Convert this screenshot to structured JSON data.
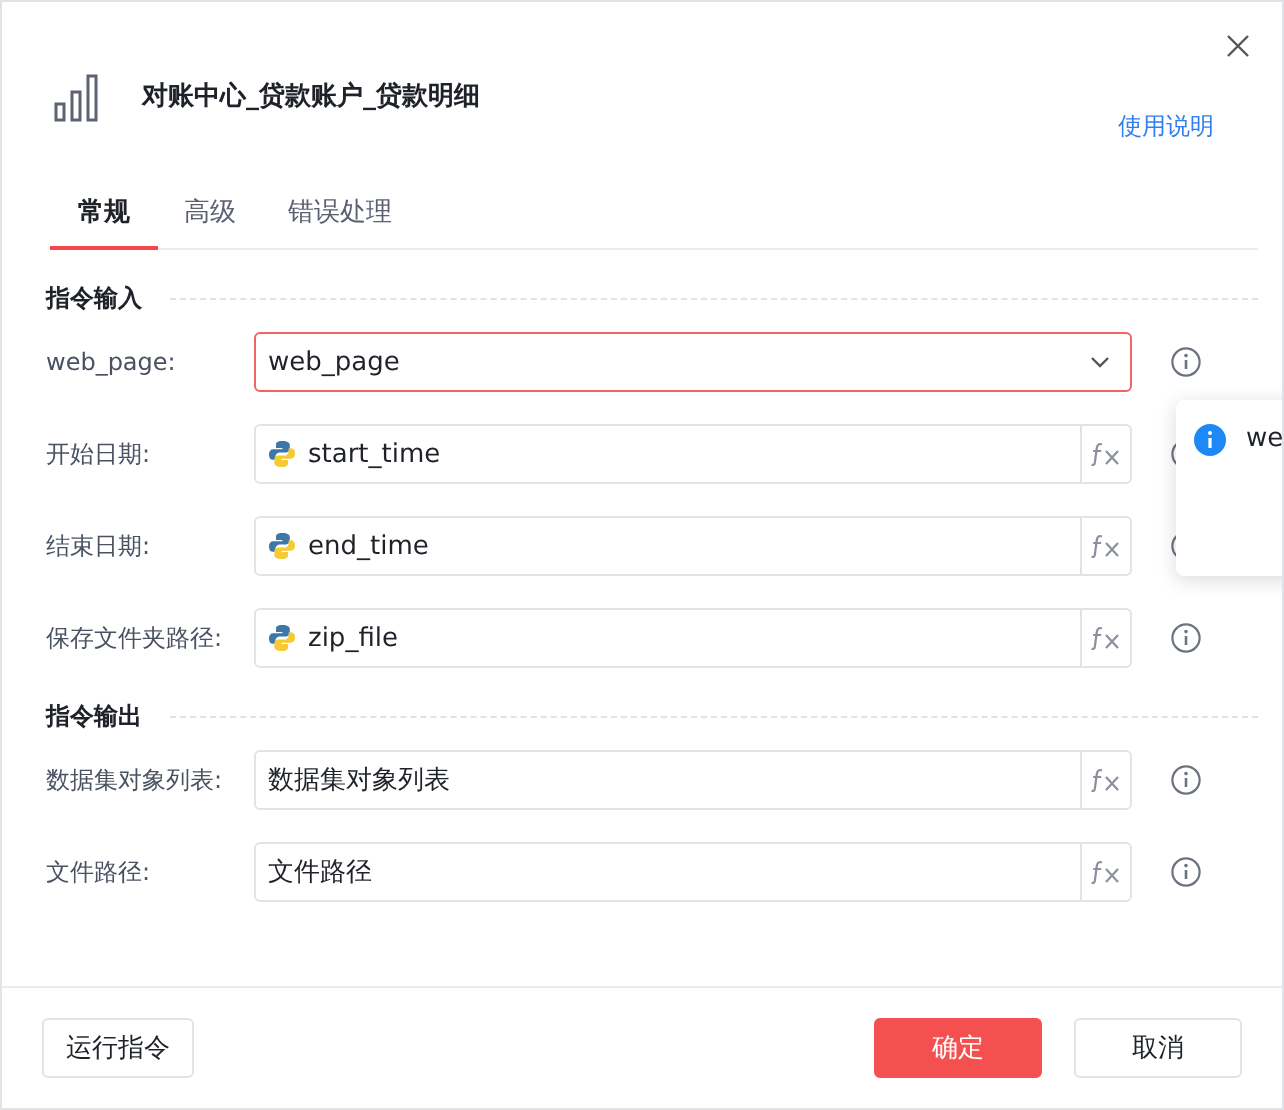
{
  "dialog": {
    "title": "对账中心_贷款账户_贷款明细",
    "help_link": "使用说明"
  },
  "tabs": [
    {
      "label": "常规",
      "selected": true
    },
    {
      "label": "高级",
      "selected": false
    },
    {
      "label": "错误处理",
      "selected": false
    }
  ],
  "sections": [
    {
      "title": "指令输入",
      "rows": [
        {
          "label": "web_page:",
          "value": "web_page",
          "kind": "select",
          "error": true
        },
        {
          "label": "开始日期:",
          "value": "start_time",
          "kind": "variable",
          "error": false
        },
        {
          "label": "结束日期:",
          "value": "end_time",
          "kind": "variable",
          "error": false
        },
        {
          "label": "保存文件夹路径:",
          "value": "zip_file",
          "kind": "variable",
          "error": false
        }
      ]
    },
    {
      "title": "指令输出",
      "rows": [
        {
          "label": "数据集对象列表:",
          "value": "数据集对象列表",
          "kind": "text",
          "error": false
        },
        {
          "label": "文件路径:",
          "value": "文件路径",
          "kind": "text",
          "error": false
        }
      ]
    }
  ],
  "popover": {
    "text": "we"
  },
  "footer": {
    "run_button": "运行指令",
    "ok_button": "确定",
    "cancel_button": "取消"
  }
}
